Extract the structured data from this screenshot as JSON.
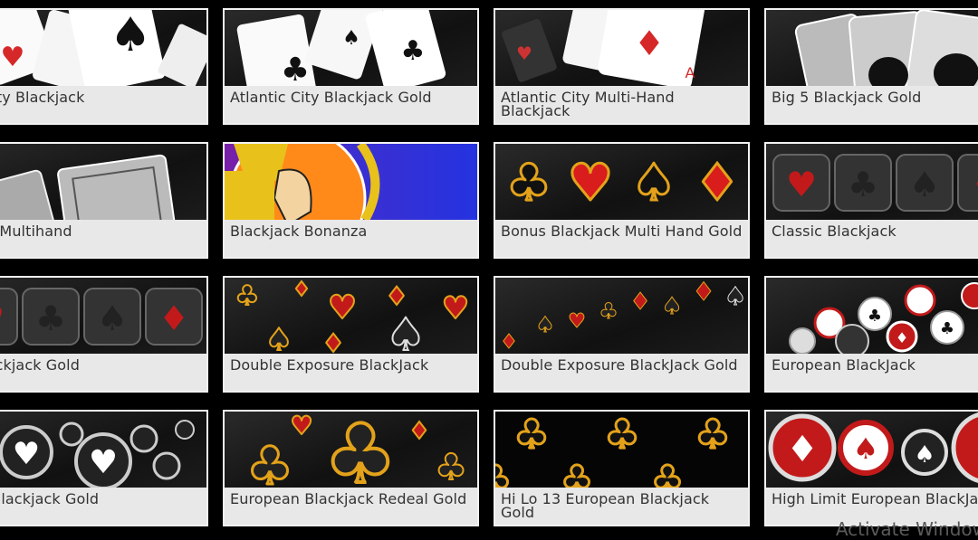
{
  "games": [
    {
      "title": "tic City Blackjack",
      "art": "white-cards-spade"
    },
    {
      "title": "Atlantic City Blackjack Gold",
      "art": "white-cards-club"
    },
    {
      "title": "Atlantic City Multi-Hand Blackjack",
      "art": "white-cards-diamond"
    },
    {
      "title": "Big 5 Blackjack Gold",
      "art": "ornate-card-backs"
    },
    {
      "title": "ack - Multihand",
      "art": "ornate-card-backs-dark"
    },
    {
      "title": "Blackjack Bonanza",
      "art": "jack-face-card"
    },
    {
      "title": "Bonus Blackjack Multi Hand Gold",
      "art": "gold-suits-row"
    },
    {
      "title": "Classic Blackjack",
      "art": "glass-suit-tiles"
    },
    {
      "title": "c Blackjack Gold",
      "art": "glass-suit-tiles-red"
    },
    {
      "title": "Double Exposure BlackJack",
      "art": "scattered-gold-suits"
    },
    {
      "title": "Double Exposure BlackJack Gold",
      "art": "wave-suits"
    },
    {
      "title": "European BlackJack",
      "art": "chip-bubbles"
    },
    {
      "title": "ean Blackjack Gold",
      "art": "silver-bubbles"
    },
    {
      "title": "European Blackjack Redeal Gold",
      "art": "big-club-gold"
    },
    {
      "title": "Hi Lo 13 European Blackjack Gold",
      "art": "gold-clubs-rows"
    },
    {
      "title": "High Limit European BlackJack",
      "art": "red-chips"
    }
  ],
  "watermark": "Activate Window",
  "colors": {
    "background": "#000000",
    "tile_border": "#f2f2f2",
    "label_bg": "#e8e8e8",
    "label_text": "#333333"
  }
}
